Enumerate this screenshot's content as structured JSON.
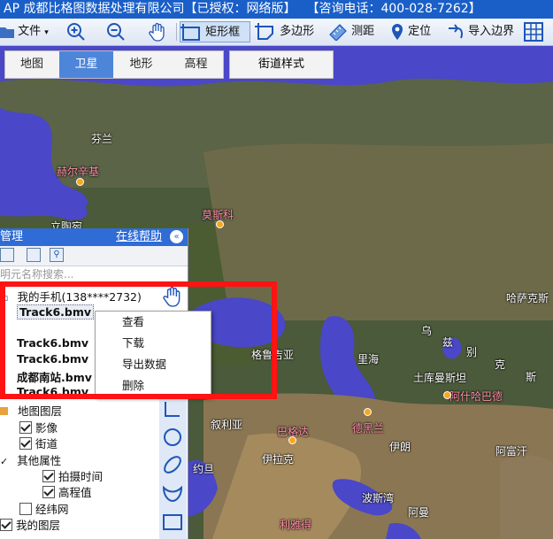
{
  "window": {
    "title_app": "AP 成都比格图数据处理有限公司",
    "title_license": "【已授权：网络版】",
    "title_phone": "【咨询电话：400-028-7262】"
  },
  "toolbar": {
    "file_label": "文件",
    "rect_label": "矩形框",
    "polygon_label": "多边形",
    "measure_label": "测距",
    "locate_label": "定位",
    "import_boundary_label": "导入边界"
  },
  "map_tabs": {
    "items": [
      {
        "label": "地图"
      },
      {
        "label": "卫星"
      },
      {
        "label": "地形"
      },
      {
        "label": "高程"
      }
    ],
    "selected": "卫星",
    "street_style_label": "街道样式"
  },
  "map_labels": {
    "finland": "芬兰",
    "helsinki": "赫尔辛基",
    "moscow": "莫斯科",
    "lithuania": "立陶宛",
    "georgia": "格鲁吉亚",
    "caspian": "里海",
    "kazakhstan": "哈萨克斯",
    "uzbekistan": "乌",
    "uzbekistan2": "兹",
    "uzbekistan3": "别",
    "uzbekistan4": "克",
    "turkmenistan": "土库曼斯坦",
    "ashgabat": "阿什哈巴德",
    "si": "斯",
    "syria": "叙利亚",
    "baghdad": "巴格达",
    "tehran": "德黑兰",
    "iran": "伊朗",
    "afghan": "阿富汗",
    "iraq": "伊拉克",
    "jordan": "约旦",
    "persian_gulf": "波斯湾",
    "oman": "阿曼",
    "riyadh": "利雅得"
  },
  "panel": {
    "title": "管理",
    "help_link": "在线帮助",
    "search_placeholder": "明元名称搜索...",
    "device_label": "我的手机(138****2732)",
    "files": [
      "Track6.bmv",
      "Track6.bmv",
      "Track6.bmv",
      "成都南站.bmv",
      "Track6.bmv"
    ],
    "map_layers_label": "地图图层",
    "image_label": "影像",
    "street_label": "街道",
    "other_props_label": "其他属性",
    "shoot_time_label": "拍摄时间",
    "elevation_label": "高程值",
    "graticule_label": "经纬网",
    "my_layers_label": "我的图层",
    "checks": {
      "image": true,
      "street": true,
      "shoot_time": true,
      "elevation": true,
      "graticule": false,
      "my_layers": true
    }
  },
  "context_menu": {
    "items": [
      "查看",
      "下载",
      "导出数据",
      "删除"
    ]
  },
  "colors": {
    "title_bar": "#1a5fc8",
    "selected_tab": "#4d86d9",
    "highlight": "#ff1313",
    "water": "#4a47c8"
  }
}
